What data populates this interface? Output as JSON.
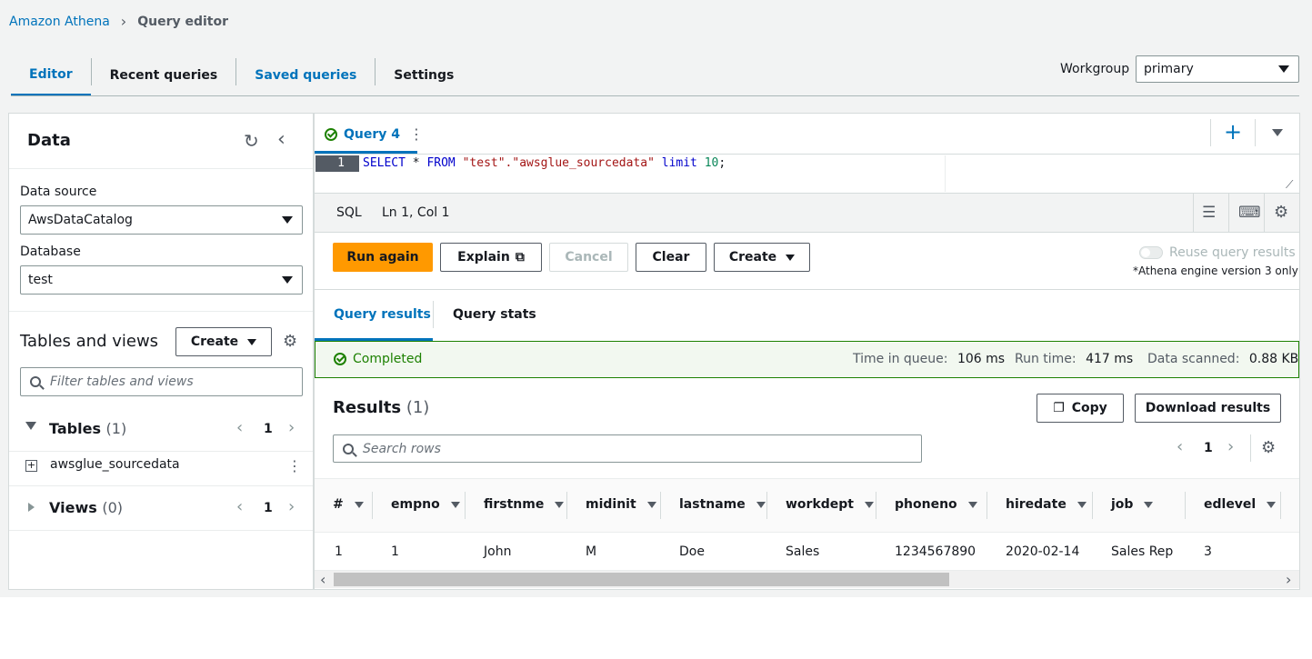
{
  "breadcrumb": {
    "root": "Amazon Athena",
    "current": "Query editor"
  },
  "tabs": [
    {
      "label": "Editor"
    },
    {
      "label": "Recent queries"
    },
    {
      "label": "Saved queries"
    },
    {
      "label": "Settings"
    }
  ],
  "workgroup": {
    "label": "Workgroup",
    "value": "primary"
  },
  "data_panel": {
    "title": "Data",
    "data_source_label": "Data source",
    "data_source_value": "AwsDataCatalog",
    "database_label": "Database",
    "database_value": "test",
    "tables_views_title": "Tables and views",
    "create_label": "Create",
    "filter_placeholder": "Filter tables and views",
    "tables_label": "Tables",
    "tables_count": "(1)",
    "tables_page": "1",
    "table_item": "awsglue_sourcedata",
    "views_label": "Views",
    "views_count": "(0)",
    "views_page": "1"
  },
  "editor": {
    "query_tab": "Query 4",
    "line_number": "1",
    "status_lang": "SQL",
    "status_pos": "Ln 1, Col 1",
    "code": {
      "k1": "SELECT",
      "t1": " * ",
      "k2": "FROM",
      "t2": " ",
      "s1": "\"test\".\"awsglue_sourcedata\"",
      "t3": " ",
      "k3": "limit",
      "t4": " ",
      "n1": "10",
      "t5": ";"
    }
  },
  "actions": {
    "run_again": "Run again",
    "explain": "Explain",
    "cancel": "Cancel",
    "clear": "Clear",
    "create": "Create",
    "reuse": "Reuse query results",
    "engine_note": "*Athena engine version 3 only"
  },
  "results_tabs": {
    "results": "Query results",
    "stats": "Query stats"
  },
  "status": {
    "state": "Completed",
    "queue_label": "Time in queue:",
    "queue_value": "106 ms",
    "run_label": "Run time:",
    "run_value": "417 ms",
    "scanned_label": "Data scanned:",
    "scanned_value": "0.88 KB"
  },
  "results": {
    "title": "Results",
    "count": "(1)",
    "copy": "Copy",
    "download": "Download results",
    "search_placeholder": "Search rows",
    "page": "1",
    "columns": [
      "#",
      "empno",
      "firstnme",
      "midinit",
      "lastname",
      "workdept",
      "phoneno",
      "hiredate",
      "job",
      "edlevel"
    ],
    "rows": [
      [
        "1",
        "1",
        "John",
        "M",
        "Doe",
        "Sales",
        "1234567890",
        "2020-02-14",
        "Sales Rep",
        "3"
      ]
    ]
  },
  "colors": {
    "accent": "#0073bb",
    "primary_button": "#ff9900",
    "success": "#1d8102"
  }
}
